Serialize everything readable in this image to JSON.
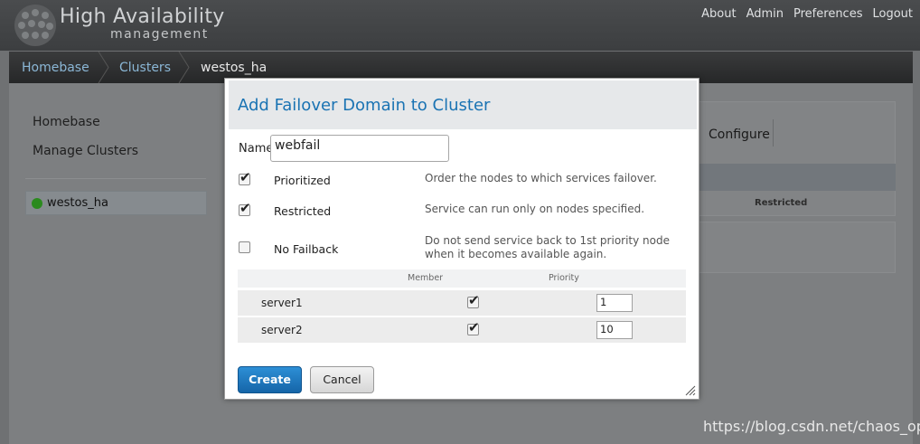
{
  "app": {
    "title": "High Availability",
    "subtitle": "management",
    "nav": [
      "About",
      "Admin",
      "Preferences",
      "Logout"
    ]
  },
  "breadcrumb": [
    "Homebase",
    "Clusters",
    "westos_ha"
  ],
  "sidebar": {
    "links": [
      "Homebase",
      "Manage Clusters"
    ],
    "cluster": {
      "name": "westos_ha",
      "status_color": "#2b8a1e"
    }
  },
  "background": {
    "configure_tab": "Configure",
    "restricted_header": "Restricted"
  },
  "dialog": {
    "title": "Add Failover Domain to Cluster",
    "name_label": "Name",
    "name_value": "webfail",
    "options": [
      {
        "label": "Prioritized",
        "checked": true,
        "description": "Order the nodes to which services failover."
      },
      {
        "label": "Restricted",
        "checked": true,
        "description": "Service can run only on nodes specified."
      },
      {
        "label": "No Failback",
        "checked": false,
        "description": "Do not send service back to 1st priority node when it becomes available again."
      }
    ],
    "table": {
      "headers": {
        "member": "Member",
        "priority": "Priority"
      },
      "rows": [
        {
          "name": "server1",
          "member": true,
          "priority": "1"
        },
        {
          "name": "server2",
          "member": true,
          "priority": "10"
        }
      ]
    },
    "create_label": "Create",
    "cancel_label": "Cancel"
  },
  "watermark": "https://blog.csdn.net/chaos_oper",
  "colors": {
    "accent": "#1a73b3",
    "button": "#1b75bb",
    "status_ok": "#2b8a1e"
  }
}
